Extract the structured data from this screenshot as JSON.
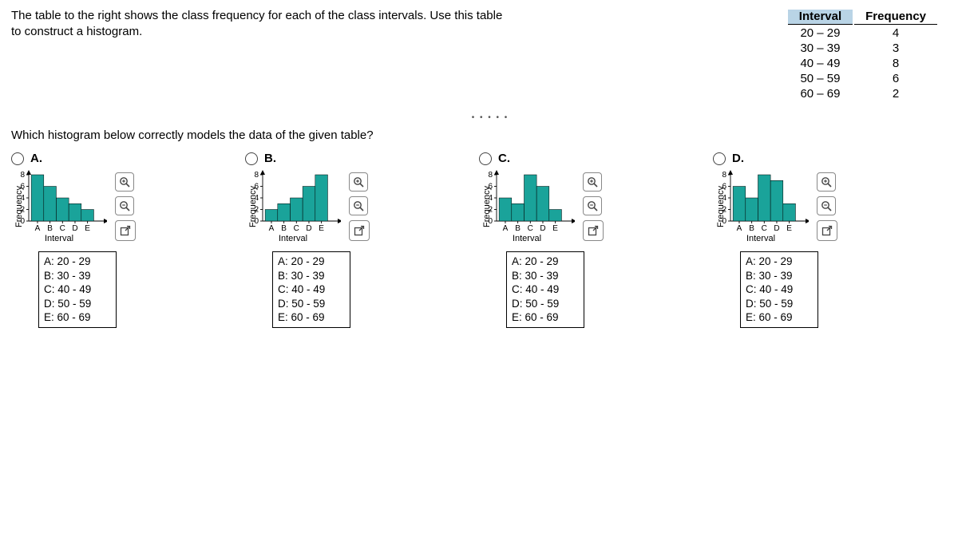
{
  "prompt_line1": "The table to the right shows the class frequency for each of the class intervals. Use this table",
  "prompt_line2": "to construct a histogram.",
  "table": {
    "head_interval": "Interval",
    "head_freq": "Frequency",
    "rows": [
      {
        "interval": "20 – 29",
        "freq": "4"
      },
      {
        "interval": "30 – 39",
        "freq": "3"
      },
      {
        "interval": "40 – 49",
        "freq": "8"
      },
      {
        "interval": "50 – 59",
        "freq": "6"
      },
      {
        "interval": "60 – 69",
        "freq": "2"
      }
    ]
  },
  "question": "Which histogram below correctly models the data of the given table?",
  "axis": {
    "ylabel": "Frequency",
    "xlabel": "Interval",
    "yticks": [
      "0",
      "2",
      "4",
      "6",
      "8"
    ],
    "xticks": [
      "A",
      "B",
      "C",
      "D",
      "E"
    ]
  },
  "legend": {
    "A": "A: 20 - 29",
    "B": "B: 30 - 39",
    "C": "C: 40 - 49",
    "D": "D: 50 - 59",
    "E": "E: 60 - 69"
  },
  "options": {
    "A": {
      "label": "A."
    },
    "B": {
      "label": "B."
    },
    "C": {
      "label": "C."
    },
    "D": {
      "label": "D."
    }
  },
  "chart_data": [
    {
      "type": "bar",
      "option": "A",
      "categories": [
        "A",
        "B",
        "C",
        "D",
        "E"
      ],
      "values": [
        8,
        6,
        4,
        3,
        2
      ],
      "ylim": [
        0,
        8
      ],
      "xlabel": "Interval",
      "ylabel": "Frequency"
    },
    {
      "type": "bar",
      "option": "B",
      "categories": [
        "A",
        "B",
        "C",
        "D",
        "E"
      ],
      "values": [
        2,
        3,
        4,
        6,
        8
      ],
      "ylim": [
        0,
        8
      ],
      "xlabel": "Interval",
      "ylabel": "Frequency"
    },
    {
      "type": "bar",
      "option": "C",
      "categories": [
        "A",
        "B",
        "C",
        "D",
        "E"
      ],
      "values": [
        4,
        3,
        8,
        6,
        2
      ],
      "ylim": [
        0,
        8
      ],
      "xlabel": "Interval",
      "ylabel": "Frequency"
    },
    {
      "type": "bar",
      "option": "D",
      "categories": [
        "A",
        "B",
        "C",
        "D",
        "E"
      ],
      "values": [
        6,
        4,
        8,
        7,
        3
      ],
      "ylim": [
        0,
        8
      ],
      "xlabel": "Interval",
      "ylabel": "Frequency"
    }
  ]
}
